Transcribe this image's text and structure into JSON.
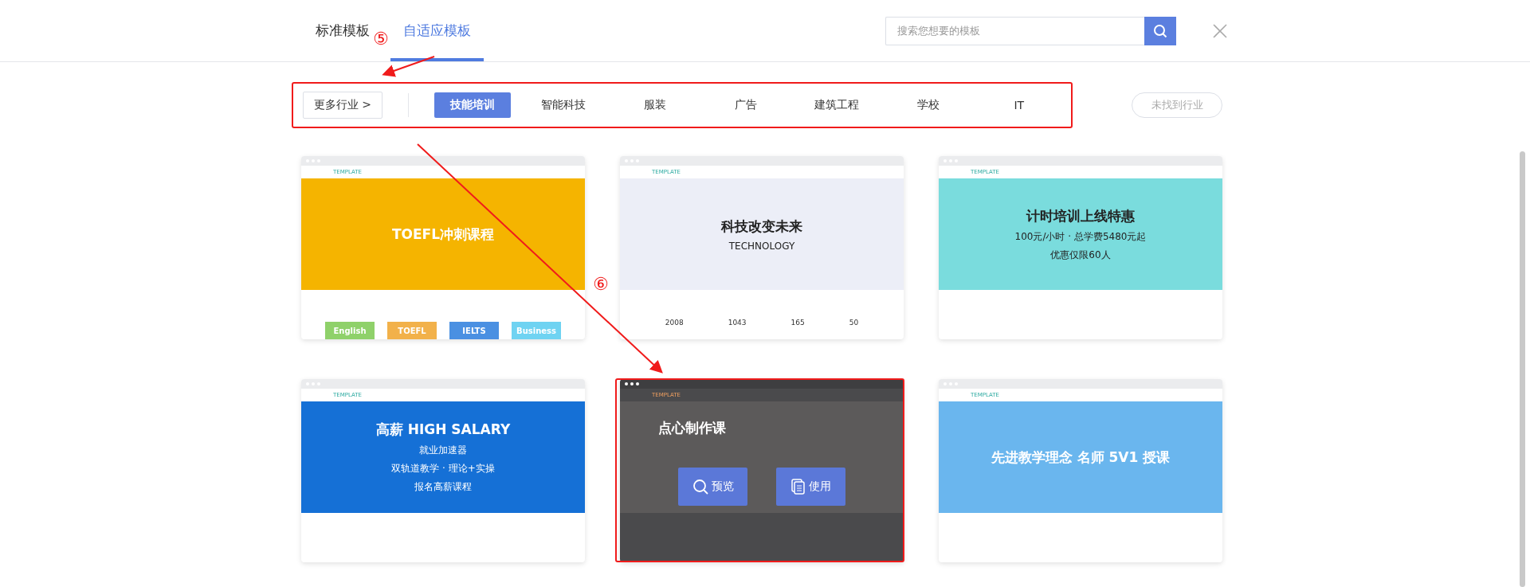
{
  "tabs": [
    {
      "label": "标准模板",
      "selected": false
    },
    {
      "label": "自适应模板",
      "selected": true
    }
  ],
  "search": {
    "placeholder": "搜索您想要的模板"
  },
  "more_button": "更多行业 >",
  "industries": [
    {
      "label": "技能培训",
      "selected": true
    },
    {
      "label": "智能科技",
      "selected": false
    },
    {
      "label": "服装",
      "selected": false
    },
    {
      "label": "广告",
      "selected": false
    },
    {
      "label": "建筑工程",
      "selected": false
    },
    {
      "label": "学校",
      "selected": false
    },
    {
      "label": "IT",
      "selected": false
    }
  ],
  "not_found_button": "未找到行业",
  "templates": [
    {
      "logo": "TEMPLATE",
      "color": "#f5b400",
      "hero_lines": [
        "TOEFL冲刺课程"
      ],
      "footer": {
        "kind": "tiles",
        "items": [
          "English",
          "TOEFL",
          "IELTS",
          "Business"
        ]
      },
      "hovered": false
    },
    {
      "logo": "TEMPLATE",
      "color": "#eceef7",
      "hero_lines": [
        "科技改变未来",
        "TECHNOLOGY"
      ],
      "footer": {
        "kind": "stats",
        "items": [
          "2008",
          "1043",
          "165",
          "50"
        ]
      },
      "hovered": false
    },
    {
      "logo": "TEMPLATE",
      "color": "#7adcdd",
      "hero_lines": [
        "计时培训上线特惠",
        "100元/小时 · 总学费5480元起",
        "优惠仅限60人"
      ],
      "hovered": false
    },
    {
      "logo": "TEMPLATE",
      "color": "#1570d6",
      "hero_lines": [
        "高薪 HIGH SALARY",
        "就业加速器",
        "双轨道教学 · 理论+实操",
        "报名高薪课程"
      ],
      "hovered": false
    },
    {
      "logo": "TEMPLATE",
      "color": "#5c5a5a",
      "hero_lines": [
        "点心制作课"
      ],
      "hovered": true
    },
    {
      "logo": "TEMPLATE",
      "color": "#6ab6ee",
      "hero_lines": [
        "先进教学理念 名师 5V1 授课"
      ],
      "hovered": false
    }
  ],
  "hover_actions": [
    "预览",
    "使用"
  ],
  "annotations": [
    {
      "label": "⑤"
    },
    {
      "label": "⑥"
    }
  ]
}
